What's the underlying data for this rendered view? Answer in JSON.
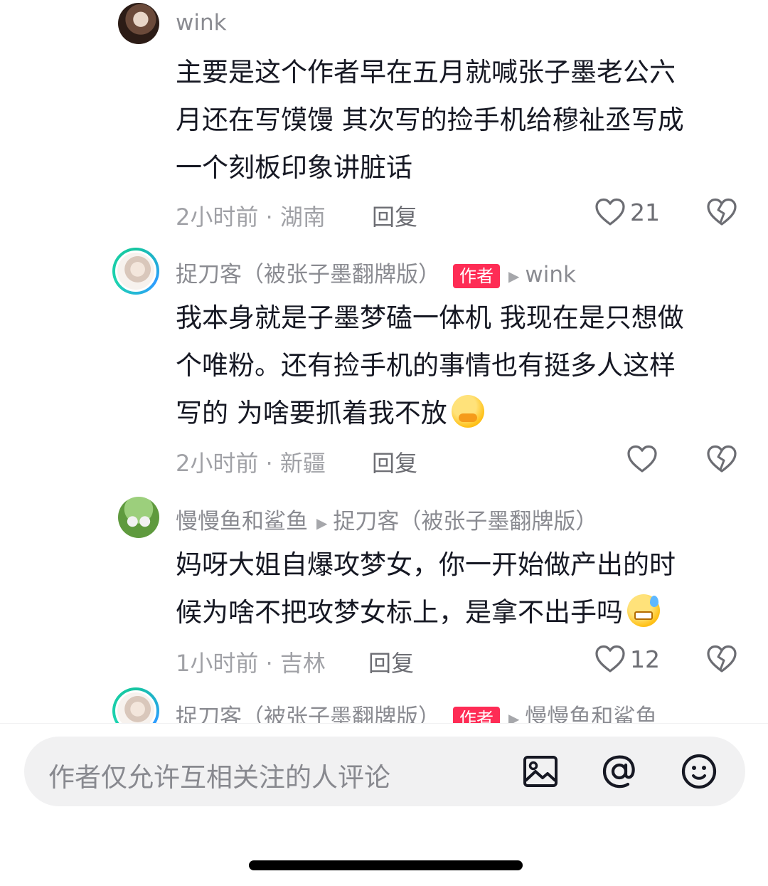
{
  "comments": [
    {
      "username": "wink",
      "text_lines": [
        "主要是这个作者早在五月就喊张子墨老公六",
        "月还在写馍馒 其次写的捡手机给穆祉丞写成",
        "一个刻板印象讲脏话"
      ],
      "time_location": "2小时前 · 湖南",
      "reply_label": "回复",
      "like_count": "21",
      "emoji": "none"
    },
    {
      "username": "捉刀客（被张子墨翻牌版）",
      "badge": "作者",
      "reply_to": "wink",
      "text_lines": [
        "我本身就是子墨梦磕一体机 我现在是只想做",
        "个唯粉。还有捡手机的事情也有挺多人这样",
        "写的 为啥要抓着我不放"
      ],
      "time_location": "2小时前 · 新疆",
      "reply_label": "回复",
      "like_count": "",
      "emoji": "face-holding-back-tears"
    },
    {
      "username": "慢慢鱼和鲨鱼",
      "reply_to": "捉刀客（被张子墨翻牌版）",
      "text_lines": [
        "妈呀大姐自爆攻梦女，你一开始做产出的时",
        "候为啥不把攻梦女标上，是拿不出手吗"
      ],
      "time_location": "1小时前 · 吉林",
      "reply_label": "回复",
      "like_count": "12",
      "emoji": "grinning-face-with-sweat"
    },
    {
      "username": "捉刀客（被张子墨翻牌版）",
      "badge": "作者",
      "reply_to": "慢慢鱼和鲨鱼"
    }
  ],
  "input": {
    "placeholder": "作者仅允许互相关注的人评论"
  },
  "icons": {
    "like": "heart-outline-icon",
    "dislike": "broken-heart-icon",
    "image": "image-icon",
    "mention": "at-sign-icon",
    "emoji": "smiley-icon"
  },
  "colors": {
    "badge": "#fe2c55",
    "secondary_text": "#8a8b91",
    "input_bg": "#f1f1f2"
  }
}
